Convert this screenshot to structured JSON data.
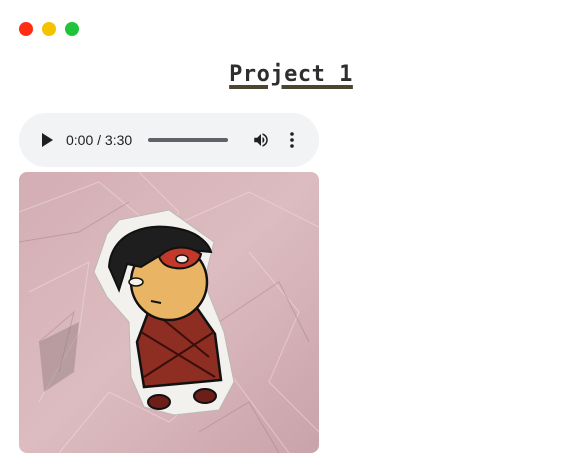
{
  "window": {
    "controls": [
      {
        "name": "close",
        "color": "#ff2d14"
      },
      {
        "name": "minimize",
        "color": "#f5c200"
      },
      {
        "name": "maximize",
        "color": "#1fc43a"
      }
    ]
  },
  "page": {
    "title": "Project 1"
  },
  "audio_player": {
    "play_icon": "play-icon",
    "time_display": "0:00 / 3:30",
    "progress": 0.0,
    "volume_icon": "volume-icon",
    "more_icon": "more-vert-icon",
    "background_color": "#f1f3f4"
  },
  "artwork": {
    "paper_color": "#d9b3b8",
    "hair_color": "#1e1e1e",
    "skin_color": "#e9b464",
    "robe_color": "#8e2e22",
    "mask_color": "#c0392b"
  }
}
